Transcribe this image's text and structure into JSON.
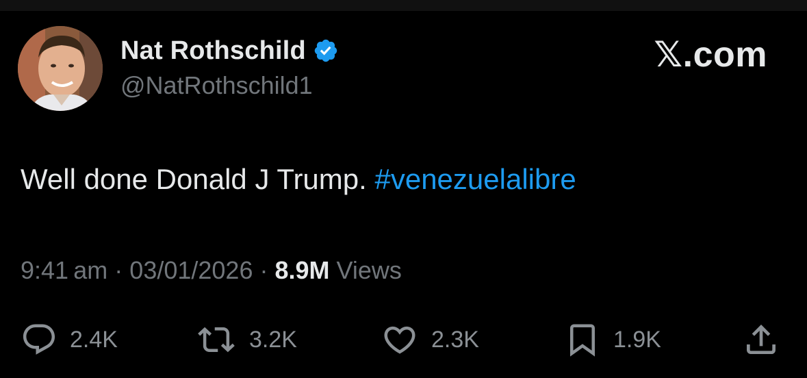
{
  "author": {
    "display_name": "Nat Rothschild",
    "handle": "@NatRothschild1",
    "verified": true
  },
  "brand": {
    "label": "𝕏.com"
  },
  "tweet": {
    "text": "Well done Donald J Trump.",
    "hashtag": "#venezuelalibre"
  },
  "meta": {
    "time": "9:41 am",
    "separator": " · ",
    "date": "03/01/2026",
    "views_count": "8.9M",
    "views_label": " Views"
  },
  "actions": {
    "replies": "2.4K",
    "reposts": "3.2K",
    "likes": "2.3K",
    "bookmarks": "1.9K"
  },
  "colors": {
    "background": "#000000",
    "text": "#e7e9ea",
    "secondary": "#71767b",
    "link": "#1d9bf0",
    "verified": "#1d9bf0"
  }
}
